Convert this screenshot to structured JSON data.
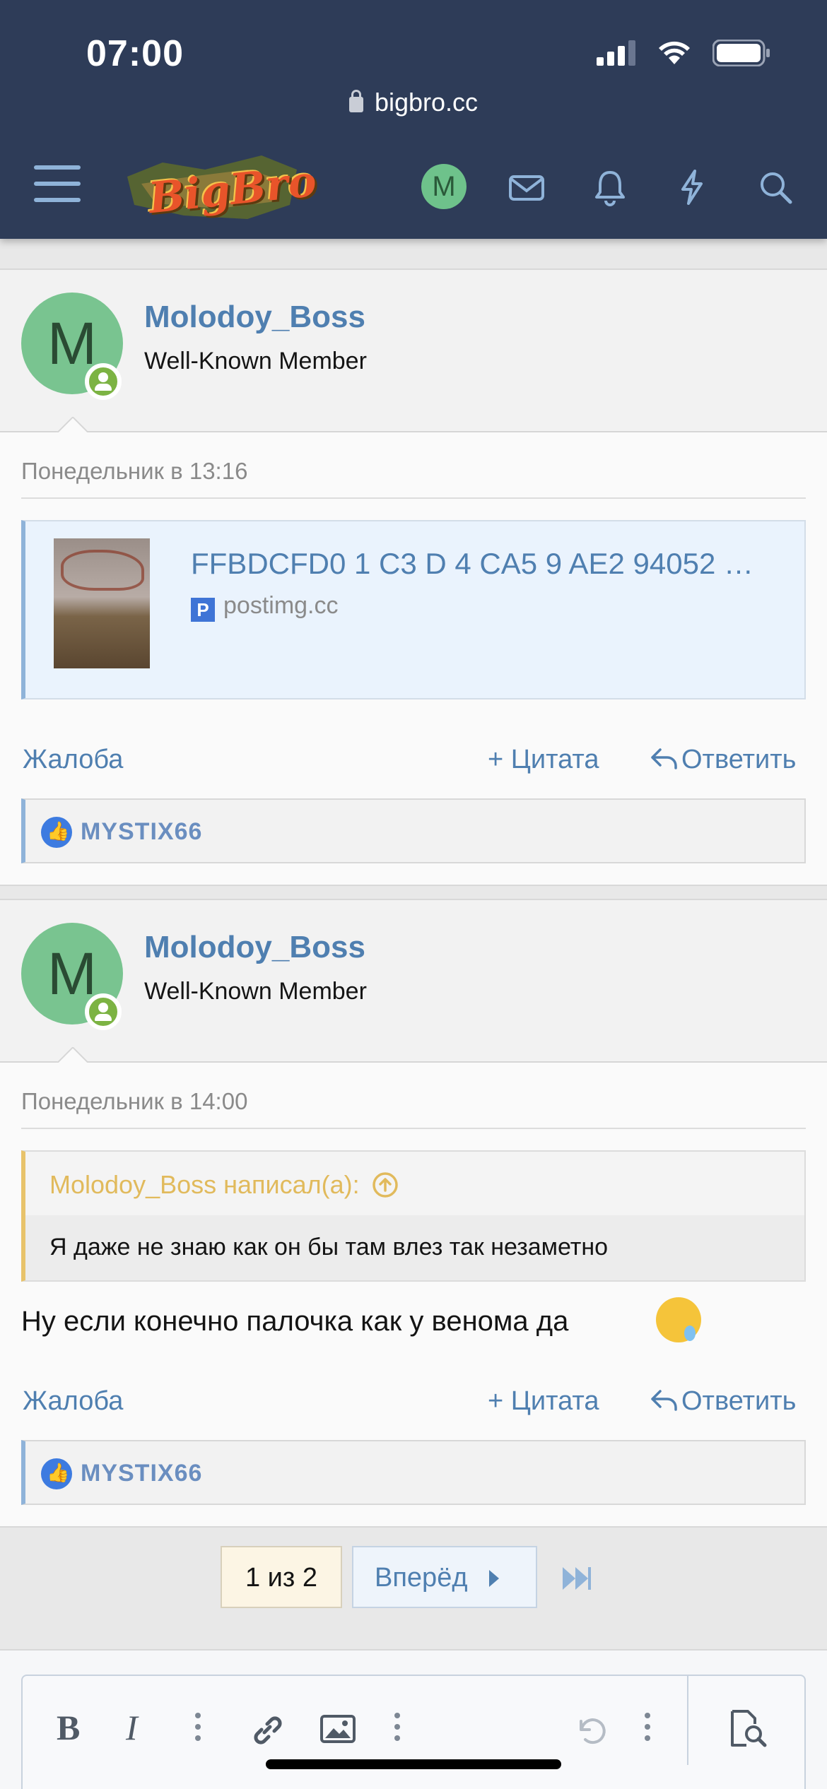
{
  "status_bar": {
    "time": "07:00"
  },
  "browser": {
    "url": "bigbro.cc"
  },
  "nav": {
    "logo_text": "BigBro",
    "account_initial": "M"
  },
  "posts": [
    {
      "avatar_initial": "M",
      "username": "Molodoy_Boss",
      "user_title": "Well-Known Member",
      "date": "Понедельник в 13:16",
      "embed": {
        "title": "FFBDCFD0 1 C3 D 4 CA5 9 AE2 94052 …",
        "source": "postimg.cc",
        "favicon": "P"
      },
      "actions": {
        "report": "Жалоба",
        "quote": "+ Цитата",
        "reply": "Ответить"
      },
      "likes": "MYSTIX66"
    },
    {
      "avatar_initial": "M",
      "username": "Molodoy_Boss",
      "user_title": "Well-Known Member",
      "date": "Понедельник в 14:00",
      "quote": {
        "author": "Molodoy_Boss написал(а):",
        "text": "Я даже не знаю как он бы там влез так незаметно"
      },
      "text": "Ну если конечно палочка как у венома да",
      "actions": {
        "report": "Жалоба",
        "quote": "+ Цитата",
        "reply": "Ответить"
      },
      "likes": "MYSTIX66"
    }
  ],
  "pagination": {
    "current": "1 из 2",
    "next": "Вперёд"
  },
  "colors": {
    "header_bg": "#2e3c58",
    "link": "#4f7fb0",
    "quote_accent": "#e8c36b",
    "online": "#7cb343"
  }
}
